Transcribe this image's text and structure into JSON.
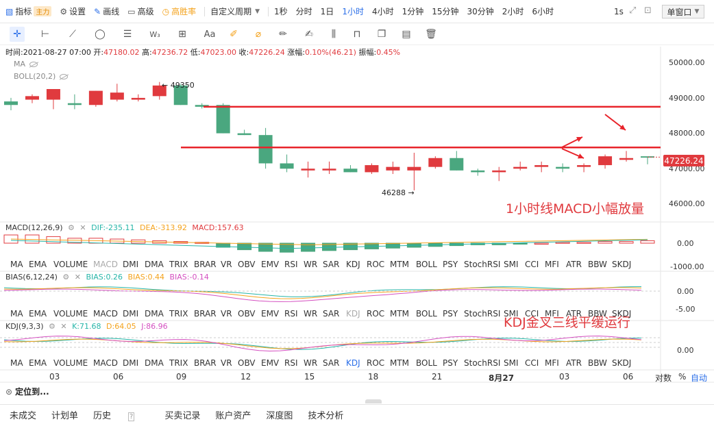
{
  "toolbar": {
    "indicator": "指标",
    "indicator_badge": "主力",
    "settings": "设置",
    "draw": "画线",
    "advanced": "高级",
    "winrate": "高胜率",
    "custom_period": "自定义周期",
    "periods": [
      "1秒",
      "分时",
      "1日",
      "1小时",
      "4小时",
      "1分钟",
      "15分钟",
      "30分钟",
      "2小时",
      "6小时"
    ],
    "active_period": "1小时",
    "interval": "1s",
    "window_mode": "单窗口"
  },
  "draw_tools": [
    "cross-cursor",
    "horizontal-line",
    "ray-line",
    "ellipse",
    "parallel-lines",
    "wave-pattern",
    "rectangle",
    "text",
    "brush",
    "eraser",
    "ruler",
    "pen",
    "candles",
    "lock",
    "copy",
    "comment",
    "delete"
  ],
  "ohlc": {
    "time_label": "时间:",
    "time": "2021-08-27 07:00",
    "open_label": "开:",
    "open": "47180.02",
    "high_label": "高:",
    "high": "47236.72",
    "low_label": "低:",
    "low": "47023.00",
    "close_label": "收:",
    "close": "47226.24",
    "change_label": "涨幅:",
    "change": "0.10%(46.21)",
    "amp_label": "振幅:",
    "amp": "0.45%"
  },
  "overlays": [
    "MA",
    "BOLL(20,2)"
  ],
  "price": {
    "yticks": [
      "50000.00",
      "49000.00",
      "48000.00",
      "47000.00",
      "46000.00"
    ],
    "ylim": [
      45550,
      50350
    ],
    "current": "47226.24",
    "high_mark": "← 49350",
    "low_mark": "46288 →",
    "candles": [
      [
        48800,
        48900,
        48550,
        48700
      ],
      [
        48850,
        49000,
        48750,
        48950
      ],
      [
        48850,
        49150,
        48580,
        49150
      ],
      [
        48750,
        49000,
        48580,
        48700
      ],
      [
        48700,
        49100,
        48650,
        49100
      ],
      [
        48850,
        49300,
        48800,
        49050
      ],
      [
        48850,
        49000,
        48800,
        48900
      ],
      [
        48950,
        49350,
        48850,
        49250
      ],
      [
        49250,
        49300,
        48700,
        48700
      ],
      [
        48700,
        48750,
        48600,
        48650
      ],
      [
        48700,
        48750,
        47900,
        47900
      ],
      [
        47900,
        48000,
        47850,
        47850
      ],
      [
        47850,
        48050,
        46900,
        47050
      ],
      [
        47050,
        47300,
        46800,
        46900
      ],
      [
        46850,
        47100,
        46650,
        46900
      ],
      [
        46850,
        47100,
        46750,
        46900
      ],
      [
        46900,
        47000,
        46800,
        46800
      ],
      [
        46800,
        47050,
        46750,
        47000
      ],
      [
        46850,
        47100,
        46750,
        46950
      ],
      [
        46850,
        47350,
        46288,
        46950
      ],
      [
        46950,
        47250,
        46900,
        47200
      ],
      [
        47200,
        47400,
        46850,
        46850
      ],
      [
        46850,
        46900,
        46700,
        46800
      ],
      [
        46800,
        46950,
        46550,
        46850
      ],
      [
        46900,
        47100,
        46850,
        46950
      ],
      [
        46950,
        47100,
        46800,
        47000
      ],
      [
        46950,
        47050,
        46800,
        46900
      ],
      [
        46950,
        47050,
        46800,
        47000
      ],
      [
        47000,
        47300,
        46900,
        47250
      ],
      [
        47150,
        47400,
        47100,
        47200
      ],
      [
        47250,
        47236.72,
        47023,
        47226.24
      ]
    ]
  },
  "levels": [
    48650,
    47500
  ],
  "macd": {
    "label": "MACD(12,26,9)",
    "dif": "DIF:-235.11",
    "dea": "DEA:-313.92",
    "macd": "MACD:157.63",
    "yticks": [
      "0.00",
      "-1000.00"
    ]
  },
  "indicator_tabs": [
    "MA",
    "EMA",
    "VOLUME",
    "MACD",
    "DMI",
    "DMA",
    "TRIX",
    "BRAR",
    "VR",
    "OBV",
    "EMV",
    "RSI",
    "WR",
    "SAR",
    "KDJ",
    "ROC",
    "MTM",
    "BOLL",
    "PSY",
    "StochRSI",
    "SMI",
    "CCI",
    "MFI",
    "ATR",
    "BBW",
    "SKDJ"
  ],
  "bias": {
    "label": "BIAS(6,12,24)",
    "b1": "BIAS:0.26",
    "b2": "BIAS:0.44",
    "b3": "BIAS:-0.14",
    "yticks": [
      "0.00",
      "-5.00"
    ]
  },
  "kdj": {
    "label": "KDJ(9,3,3)",
    "k": "K:71.68",
    "d": "D:64.05",
    "j": "J:86.96",
    "yticks": [
      "0.00"
    ]
  },
  "xaxis": [
    "03",
    "06",
    "09",
    "12",
    "15",
    "18",
    "21",
    "8月27",
    "03",
    "06"
  ],
  "axis_controls": {
    "log": "对数",
    "pct": "%",
    "auto": "自动"
  },
  "locate": "定位到...",
  "bottom_tabs": [
    "未成交",
    "计划单",
    "历史",
    "买卖记录",
    "账户资产",
    "深度图",
    "技术分析"
  ],
  "annotations": {
    "macd": "1小时线MACD小幅放量",
    "kdj": "KDJ金叉三线平缓运行"
  },
  "colors": {
    "up": "#e03a3e",
    "down": "#4aa77f",
    "accent": "#2a6ee8",
    "level": "#e8232a"
  }
}
